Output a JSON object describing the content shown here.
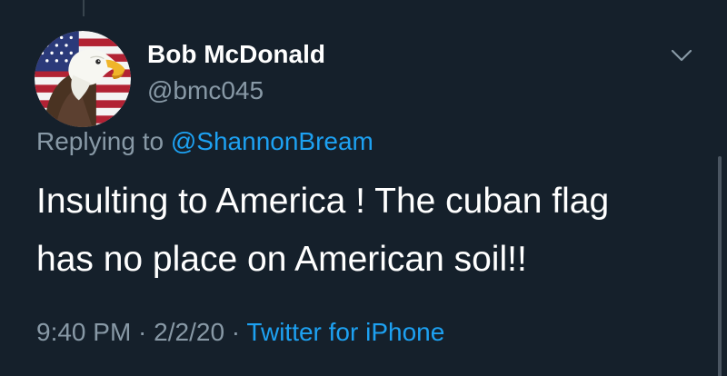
{
  "tweet": {
    "display_name": "Bob McDonald",
    "handle": "@bmc045",
    "replying_prefix": "Replying to ",
    "reply_mention": "@ShannonBream",
    "text_line1": "Insulting to America ! The cuban flag",
    "text_line2": "has no place on American soil!!",
    "time": "9:40 PM",
    "separator": " · ",
    "date": "2/2/20",
    "source": "Twitter for iPhone"
  },
  "icons": {
    "more": "chevron-down-icon",
    "avatar": "eagle-flag-avatar"
  },
  "colors": {
    "background": "#15202b",
    "primary_text": "#ffffff",
    "secondary_text": "#8899a6",
    "accent": "#1da1f2"
  }
}
